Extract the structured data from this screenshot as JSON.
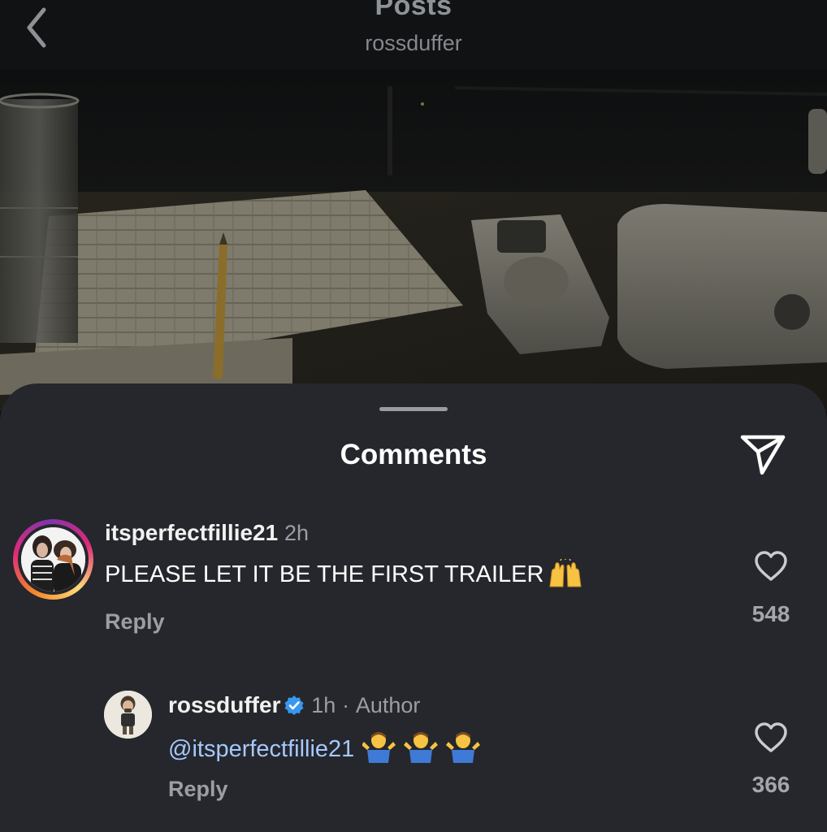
{
  "nav": {
    "title": "Posts",
    "subtitle": "rossduffer",
    "back_icon": "chevron-left-icon"
  },
  "sheet": {
    "title": "Comments",
    "share_icon": "paper-plane-icon"
  },
  "comments": [
    {
      "username": "itsperfectfillie21",
      "time": "2h",
      "text": "PLEASE LET IT BE THE FIRST TRAILER",
      "emoji": "raising-hands",
      "reply_label": "Reply",
      "likes": "548"
    },
    {
      "username": "rossduffer",
      "verified": true,
      "time": "1h",
      "separator": "·",
      "author_label": "Author",
      "mention": "@itsperfectfillie21",
      "emoji": "shrugging-man x3",
      "reply_label": "Reply",
      "likes": "366"
    }
  ],
  "colors": {
    "sheet_bg": "#25272c",
    "mention": "#a6c8ff",
    "verified": "#3897f0",
    "secondary_text": "#9c9ea3"
  }
}
